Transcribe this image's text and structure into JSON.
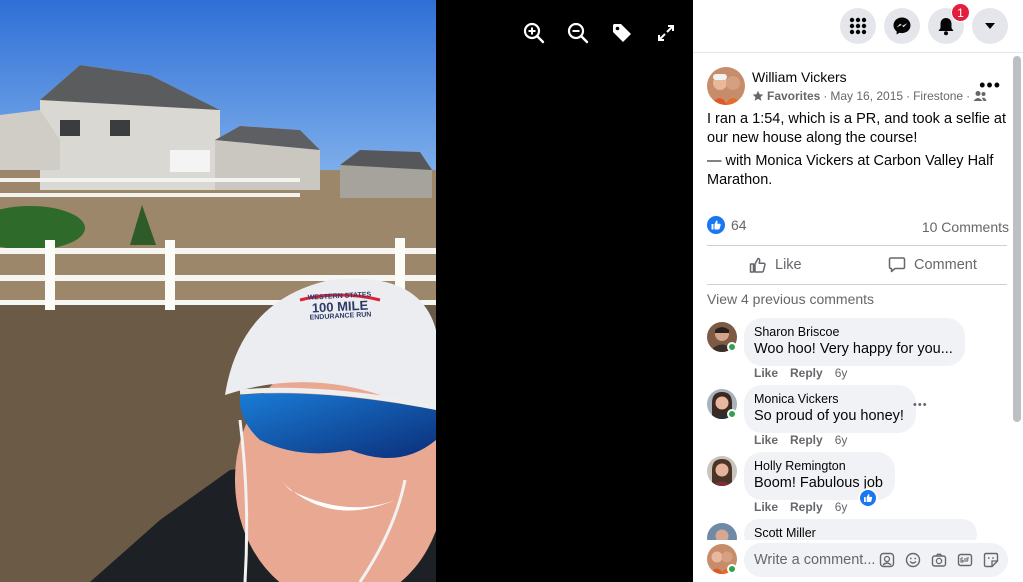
{
  "viewer": {
    "tools": [
      "zoom-in",
      "zoom-out",
      "tag",
      "fullscreen"
    ],
    "cap_text": {
      "line1": "WESTERN STATES",
      "line2": "100 MILE",
      "line3": "ENDURANCE RUN"
    }
  },
  "topbar": {
    "notifications_count": "1"
  },
  "post": {
    "author": "William Vickers",
    "favorites_label": "Favorites",
    "sep1": "·",
    "date": "May 16, 2015",
    "sep2": "·",
    "location": "Firestone",
    "sep3": "·",
    "more": "•••",
    "text": "I ran a 1:54, which is a PR, and took a selfie at our new house along the course!",
    "with_prefix": "— with ",
    "with_person": "Monica Vickers",
    "with_at": " at ",
    "with_place": "Carbon Valley Half Marathon.",
    "reaction_count": "64",
    "comments_count": "10 Comments",
    "like_label": "Like",
    "comment_label": "Comment",
    "view_previous": "View 4 previous comments"
  },
  "comments": [
    {
      "name": "Sharon Briscoe",
      "text": "Woo hoo! Very happy for you...",
      "like": "Like",
      "reply": "Reply",
      "time": "6y"
    },
    {
      "name": "Monica Vickers",
      "text": "So proud of you honey!",
      "like": "Like",
      "reply": "Reply",
      "time": "6y",
      "more": "•••"
    },
    {
      "name": "Holly Remington",
      "text": "Boom! Fabulous job",
      "like": "Like",
      "reply": "Reply",
      "time": "6y"
    },
    {
      "name": "Scott Miller"
    }
  ],
  "composer": {
    "placeholder": "Write a comment..."
  },
  "colors": {
    "accent": "#1877f2",
    "online": "#31a24c",
    "badge": "#e41e3f"
  }
}
